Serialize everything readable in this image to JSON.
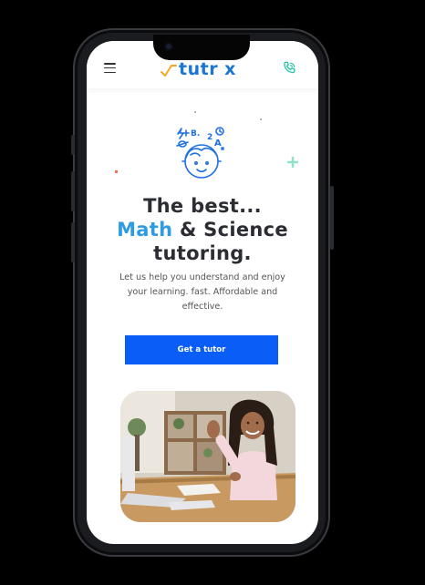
{
  "header": {
    "logo_text": "tutr x",
    "menu_icon": "hamburger-menu-icon",
    "phone_icon": "phone-call-icon"
  },
  "hero": {
    "title_line1": "The best...",
    "title_accent": "Math",
    "title_line2_rest": " & Science",
    "title_line3": "tutoring.",
    "subtitle": "Let us help you understand and enjoy your learning. fast. Affordable and effective.",
    "cta_label": "Get a tutor",
    "illustration_icon": "student-math-icon",
    "photo": "girl-waving-at-laptop-photo"
  },
  "colors": {
    "brand_blue": "#1976d2",
    "accent_blue": "#2f9be0",
    "cta_blue": "#0a5ef7",
    "logo_check": "#f5a623",
    "phone_icon": "#26c6a8",
    "title_dark": "#2b2d33"
  }
}
